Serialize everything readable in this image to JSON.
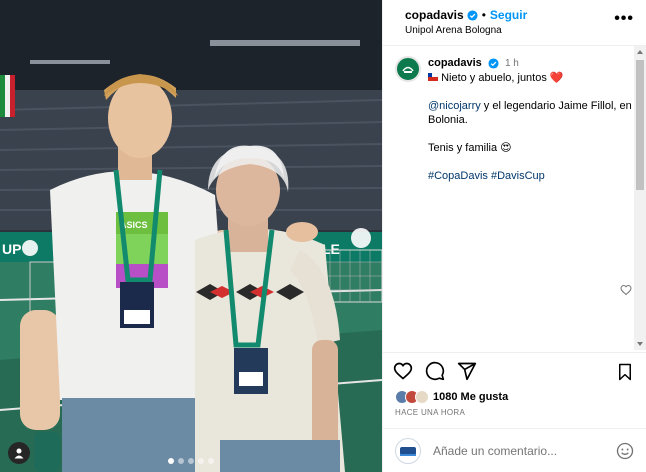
{
  "header": {
    "username": "copadavis",
    "follow_label": "Seguir",
    "separator": "•",
    "location": "Unipol Arena Bologna",
    "more_label": "•••"
  },
  "caption": {
    "username": "copadavis",
    "time": "1 h",
    "line1": "Nieto y abuelo, juntos",
    "heart_emoji": "❤️",
    "mention": "@nicojarry",
    "line2_rest": " y el legendario Jaime Fillol, en Bolonia.",
    "line3": "Tenis y familia",
    "face_emoji": "😍",
    "hashtag1": "#CopaDavis",
    "hashtag2": "#DavisCup"
  },
  "likes": {
    "count_text": "1080 Me gusta"
  },
  "posted_ago": "HACE UNA HORA",
  "comment_input": {
    "placeholder": "Añade un comentario..."
  },
  "photo": {
    "sign_left": "UP",
    "sign_right": "LE",
    "badge_text": "ASICS"
  },
  "colors": {
    "link": "#00376b",
    "follow": "#0095f6",
    "brand": "#0d7a4e",
    "muted": "#737373"
  },
  "icons": {
    "heart": "heart-icon",
    "comment": "comment-icon",
    "share": "share-icon",
    "save": "bookmark-icon",
    "emoji": "smiley-icon",
    "more": "more-options-icon"
  }
}
